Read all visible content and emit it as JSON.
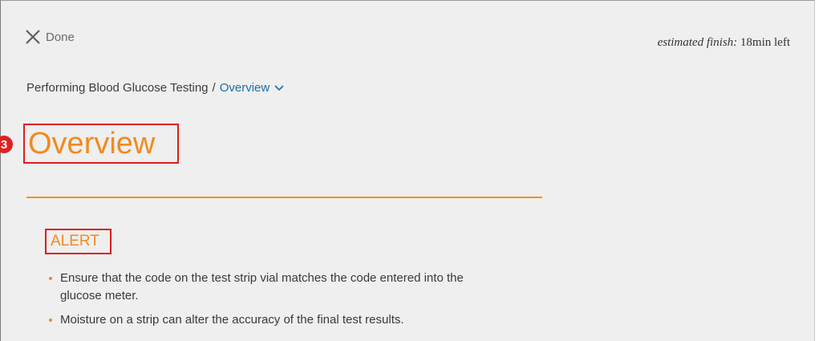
{
  "header": {
    "done_label": "Done",
    "finish_label": "estimated finish:",
    "finish_value": "18min left"
  },
  "breadcrumb": {
    "parent": "Performing Blood Glucose Testing",
    "separator": "/",
    "current": "Overview"
  },
  "step_badge": "3",
  "title": "Overview",
  "section": {
    "heading": "ALERT",
    "items": [
      "Ensure that the code on the test strip vial matches the code entered into the glucose meter.",
      "Moisture on a strip can alter the accuracy of the final test results."
    ]
  },
  "colors": {
    "accent": "#f08a1e",
    "link": "#1a6fa8",
    "highlight": "#e01c1c",
    "background": "#efefef"
  },
  "icons": {
    "close": "close-icon",
    "dropdown": "chevron-down-icon"
  }
}
